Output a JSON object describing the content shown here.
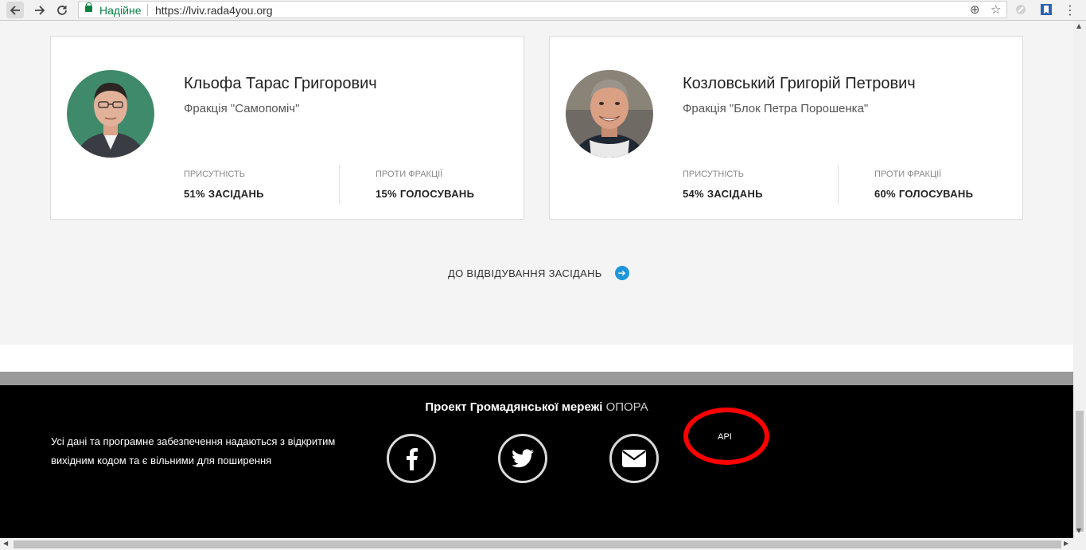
{
  "browser": {
    "secure_label": "Надійне",
    "url": "https://lviv.rada4you.org"
  },
  "cards": [
    {
      "name": "Кльофа Тарас Григорович",
      "faction": "Фракція \"Самопоміч\"",
      "attendance_label": "ПРИСУТНІСТЬ",
      "attendance_value": "51% ЗАСІДАНЬ",
      "against_label": "ПРОТИ ФРАКЦІЇ",
      "against_value": "15% ГОЛОСУВАНЬ"
    },
    {
      "name": "Козловський Григорій Петрович",
      "faction": "Фракція \"Блок Петра Порошенка\"",
      "attendance_label": "ПРИСУТНІСТЬ",
      "attendance_value": "54% ЗАСІДАНЬ",
      "against_label": "ПРОТИ ФРАКЦІЇ",
      "against_value": "60% ГОЛОСУВАНЬ"
    }
  ],
  "more_link": "ДО ВІДВІДУВАННЯ ЗАСІДАНЬ",
  "footer": {
    "project_prefix": "Проект Громадянської мережі",
    "project_org": "ОПОРА",
    "disclaimer": "Усі дані та програмне забезпечення надаються з відкритим вихідним кодом та є вільними для поширення",
    "api_label": "API"
  },
  "colors": {
    "accent_blue": "#1e96d9",
    "annotation_red": "#ff0000",
    "secure_green": "#0b8043",
    "footer_bg": "#000000"
  }
}
